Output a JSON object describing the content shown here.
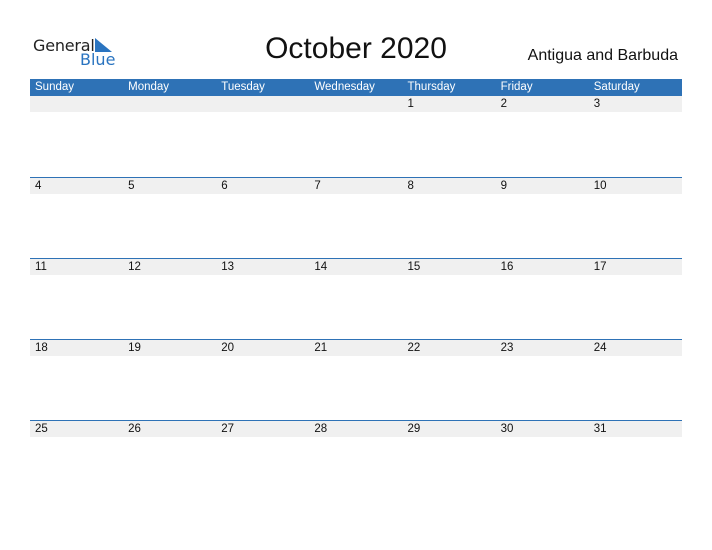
{
  "logo": {
    "word1": "General",
    "word2": "Blue"
  },
  "title": "October 2020",
  "country": "Antigua and Barbuda",
  "colors": {
    "header": "#2e72b6",
    "row_shade": "#f0f0f0",
    "brand_blue": "#2a74c0"
  },
  "weekdays": [
    "Sunday",
    "Monday",
    "Tuesday",
    "Wednesday",
    "Thursday",
    "Friday",
    "Saturday"
  ],
  "weeks": [
    [
      "",
      "",
      "",
      "",
      "1",
      "2",
      "3"
    ],
    [
      "4",
      "5",
      "6",
      "7",
      "8",
      "9",
      "10"
    ],
    [
      "11",
      "12",
      "13",
      "14",
      "15",
      "16",
      "17"
    ],
    [
      "18",
      "19",
      "20",
      "21",
      "22",
      "23",
      "24"
    ],
    [
      "25",
      "26",
      "27",
      "28",
      "29",
      "30",
      "31"
    ]
  ]
}
